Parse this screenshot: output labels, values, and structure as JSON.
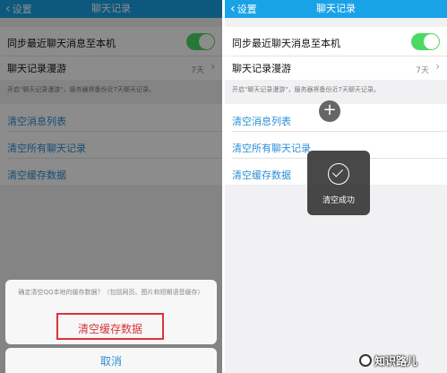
{
  "left": {
    "nav": {
      "back": "设置",
      "title": "聊天记录"
    },
    "sync_label": "同步最近聊天消息至本机",
    "roaming_label": "聊天记录漫游",
    "roaming_value": "7天",
    "hint": "开启\"聊天记录漫游\"，服务器将备份近7天聊天记录。",
    "links": [
      "清空消息列表",
      "清空所有聊天记录",
      "清空缓存数据"
    ],
    "sheet": {
      "message": "确定清空QQ本地的缓存数据？（包括网页、图片和短期语音缓存）",
      "confirm": "清空缓存数据",
      "cancel": "取消"
    }
  },
  "right": {
    "nav": {
      "back": "设置",
      "title": "聊天记录"
    },
    "sync_label": "同步最近聊天消息至本机",
    "roaming_label": "聊天记录漫游",
    "roaming_value": "7天",
    "hint": "开启\"聊天记录漫游\"，服务器将备份近7天聊天记录。",
    "links": [
      "清空消息列表",
      "清空所有聊天记录",
      "清空缓存数据"
    ],
    "toast": "清空成功"
  },
  "watermark": "知识路儿",
  "colors": {
    "navbar": "#19a3e6",
    "toggle_on": "#4cd964",
    "link": "#2b8fd6",
    "danger": "#d9343a"
  },
  "icons": {
    "toggle": "toggle-on-icon",
    "toast": "checkmark-circle-icon",
    "floating": "plus-icon"
  }
}
